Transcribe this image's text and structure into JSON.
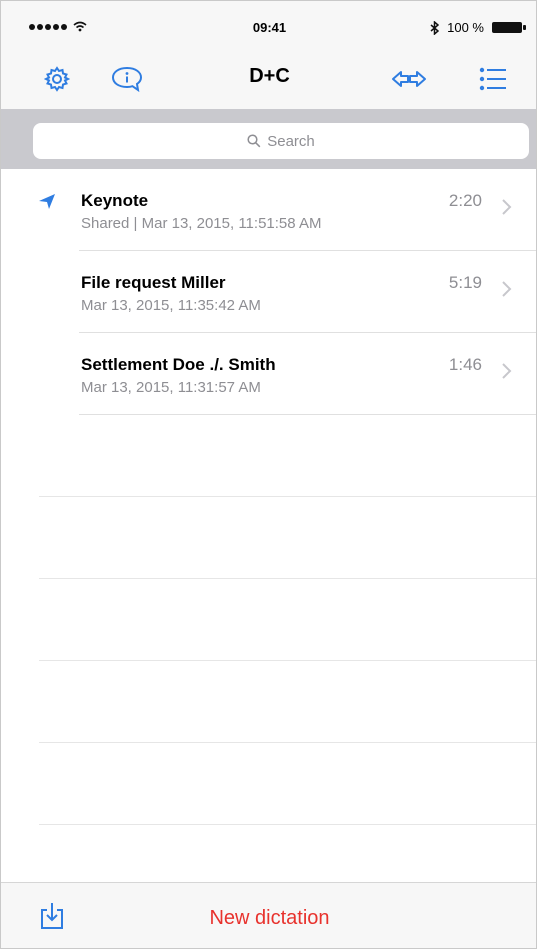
{
  "status": {
    "time": "09:41",
    "battery": "100 %"
  },
  "navbar": {
    "title": "D+C"
  },
  "search": {
    "placeholder": "Search"
  },
  "recordings": [
    {
      "title": "Keynote",
      "subtitle": "Shared | Mar 13, 2015, 11:51:58 AM",
      "duration": "2:20",
      "shared": true
    },
    {
      "title": "File request Miller",
      "subtitle": "Mar 13, 2015, 11:35:42 AM",
      "duration": "5:19",
      "shared": false
    },
    {
      "title": "Settlement Doe ./. Smith",
      "subtitle": "Mar 13, 2015, 11:31:57 AM",
      "duration": "1:46",
      "shared": false
    }
  ],
  "toolbar": {
    "new_label": "New dictation"
  },
  "colors": {
    "accent": "#2f7de1",
    "destructive": "#e8322d",
    "secondary_text": "#8e8e93"
  }
}
